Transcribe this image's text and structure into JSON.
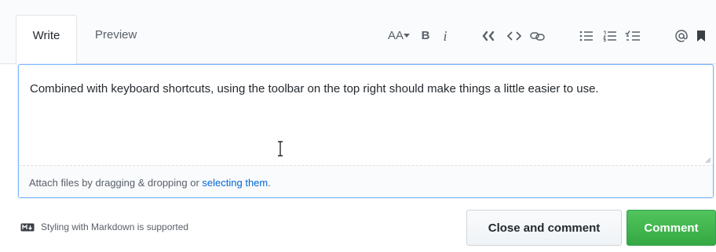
{
  "tabs": {
    "write_label": "Write",
    "preview_label": "Preview"
  },
  "toolbar": {
    "heading_label": "AA",
    "bold_label": "B",
    "italic_label": "i",
    "items": [
      "text-size-icon",
      "bold-icon",
      "italic-icon",
      "quote-icon",
      "code-icon",
      "link-icon",
      "bulleted-list-icon",
      "numbered-list-icon",
      "task-list-icon",
      "mention-icon",
      "saved-reply-icon"
    ]
  },
  "editor": {
    "value": "Combined with keyboard shortcuts, using the toolbar on the top right should make things a little easier to use.",
    "attach_text": "Attach files by dragging & dropping or ",
    "attach_link": "selecting them",
    "attach_suffix": "."
  },
  "footer": {
    "markdown_hint": "Styling with Markdown is supported",
    "close_button": "Close and comment",
    "comment_button": "Comment"
  },
  "colors": {
    "accent_blue": "#0366d6",
    "comment_green": "#2cbe4e",
    "focus_border": "#79b8ff"
  }
}
